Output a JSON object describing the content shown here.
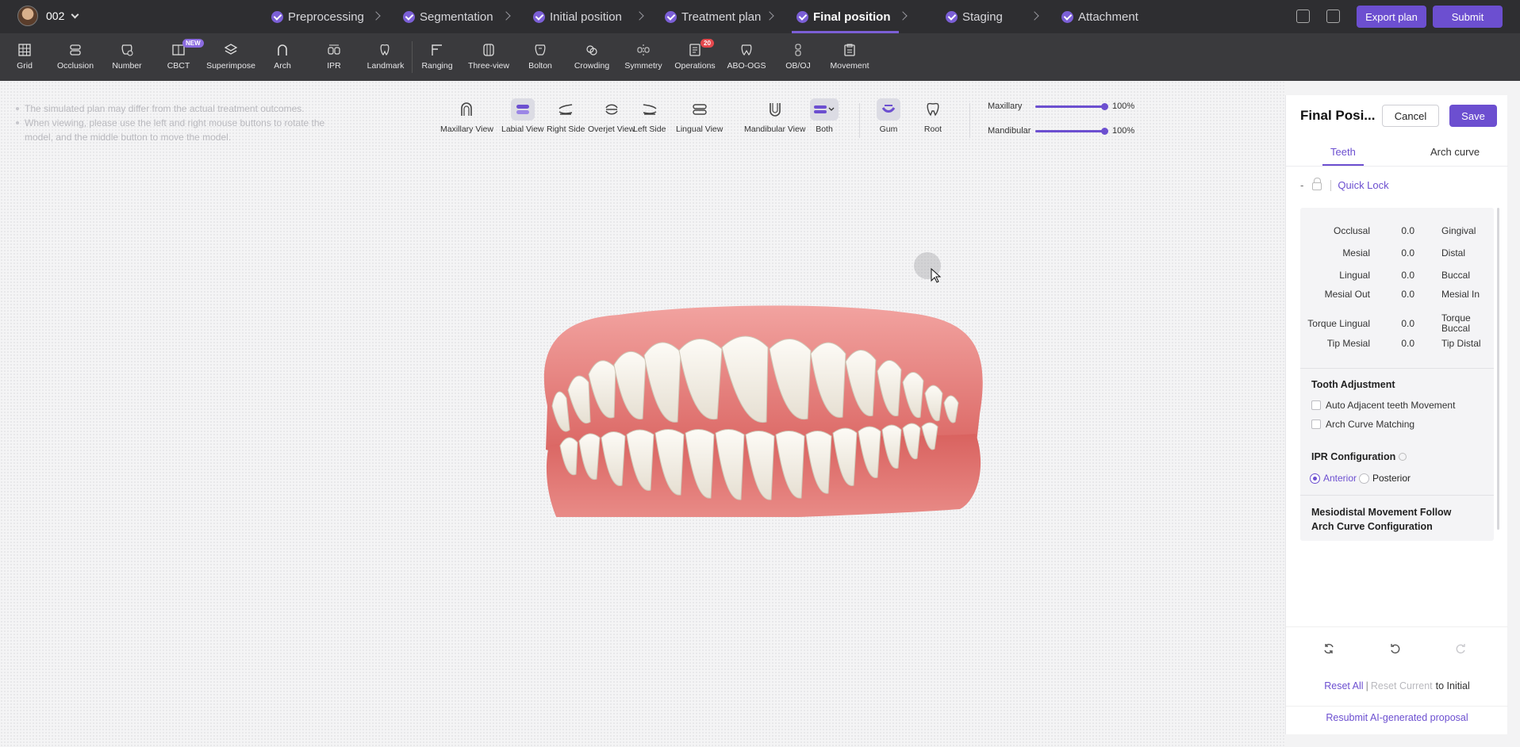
{
  "header": {
    "user_label": "002",
    "steps": [
      {
        "label": "Preprocessing",
        "state": "done"
      },
      {
        "label": "Segmentation",
        "state": "done"
      },
      {
        "label": "Initial position",
        "state": "done"
      },
      {
        "label": "Treatment plan",
        "state": "done"
      },
      {
        "label": "Final position",
        "state": "active"
      },
      {
        "label": "Staging",
        "state": "done"
      },
      {
        "label": "Attachment",
        "state": "done"
      }
    ],
    "export_label": "Export plan",
    "submit_label": "Submit",
    "accent_color": "#6c4fd0"
  },
  "toolbar": {
    "tools": [
      {
        "label": "Grid",
        "icon": "grid-icon"
      },
      {
        "label": "Occlusion",
        "icon": "occlusion-icon"
      },
      {
        "label": "Number",
        "icon": "number-icon"
      },
      {
        "label": "CBCT",
        "icon": "cbct-icon",
        "badge": "NEW"
      },
      {
        "label": "Superimpose",
        "icon": "superimpose-icon"
      },
      {
        "label": "Arch",
        "icon": "arch-icon"
      },
      {
        "label": "IPR",
        "icon": "ipr-icon"
      },
      {
        "label": "Landmark",
        "icon": "tooth-icon"
      },
      {
        "label": "Ranging",
        "icon": "ranging-icon"
      },
      {
        "label": "Three-view",
        "icon": "three-view-icon"
      },
      {
        "label": "Bolton",
        "icon": "bolton-icon"
      },
      {
        "label": "Crowding",
        "icon": "crowding-icon"
      },
      {
        "label": "Symmetry",
        "icon": "symmetry-icon"
      },
      {
        "label": "Operations",
        "icon": "operations-icon",
        "badge": "20"
      },
      {
        "label": "ABO-OGS",
        "icon": "abo-icon"
      },
      {
        "label": "OB/OJ",
        "icon": "obj-icon"
      },
      {
        "label": "Movement",
        "icon": "movement-icon"
      }
    ]
  },
  "canvas": {
    "hints": [
      "The simulated plan may differ from the actual treatment outcomes.",
      "When viewing, please use the left and right mouse buttons to rotate the model, and the middle button to move the model."
    ],
    "views": [
      {
        "label": "Maxillary View",
        "icon": "maxillary-view-icon",
        "selected": false
      },
      {
        "label": "Labial View",
        "icon": "labial-view-icon",
        "selected": true
      },
      {
        "label": "Right Side",
        "icon": "right-side-icon",
        "selected": false
      },
      {
        "label": "Overjet View",
        "icon": "overjet-view-icon",
        "selected": false
      },
      {
        "label": "Left Side",
        "icon": "left-side-icon",
        "selected": false
      },
      {
        "label": "Lingual View",
        "icon": "lingual-view-icon",
        "selected": false
      },
      {
        "label": "Mandibular View",
        "icon": "mandibular-view-icon",
        "selected": false
      },
      {
        "label": "Both",
        "icon": "both-jaws-icon",
        "selected": true
      }
    ],
    "display_toggles": [
      {
        "label": "Gum",
        "icon": "gum-icon",
        "selected": true
      },
      {
        "label": "Root",
        "icon": "root-icon",
        "selected": false
      }
    ],
    "opacity": [
      {
        "label": "Maxillary",
        "value": "100%",
        "level": 1.0
      },
      {
        "label": "Mandibular",
        "value": "100%",
        "level": 1.0
      }
    ]
  },
  "panel": {
    "title": "Final Posi...",
    "cancel_label": "Cancel",
    "save_label": "Save",
    "tabs": [
      {
        "label": "Teeth",
        "active": true
      },
      {
        "label": "Arch curve",
        "active": false
      }
    ],
    "quick_lock_prefix": "-",
    "quick_lock_label": "Quick Lock",
    "movements": [
      {
        "left": "Occlusal",
        "value": "0.0",
        "right": "Gingival"
      },
      {
        "left": "Mesial",
        "value": "0.0",
        "right": "Distal"
      },
      {
        "left": "Lingual",
        "value": "0.0",
        "right": "Buccal"
      },
      {
        "left": "Mesial Out",
        "value": "0.0",
        "right": "Mesial In"
      },
      {
        "left": "Torque Lingual",
        "value": "0.0",
        "right": "Torque Buccal"
      },
      {
        "left": "Tip Mesial",
        "value": "0.0",
        "right": "Tip Distal"
      }
    ],
    "tooth_adjustment_title": "Tooth Adjustment",
    "auto_adjacent_label": "Auto Adjacent teeth Movement",
    "arch_curve_matching_label": "Arch Curve Matching",
    "ipr_title": "IPR Configuration",
    "ipr_options": [
      {
        "label": "Anterior",
        "selected": true
      },
      {
        "label": "Posterior",
        "selected": false
      }
    ],
    "mesiodistal_title": "Mesiodistal Movement Follow Arch Curve Configuration",
    "reset_all_label": "Reset All",
    "reset_sep": "|",
    "reset_current_label": "Reset Current",
    "to_initial_label": "to Initial",
    "resubmit_label": "Resubmit AI-generated proposal"
  }
}
